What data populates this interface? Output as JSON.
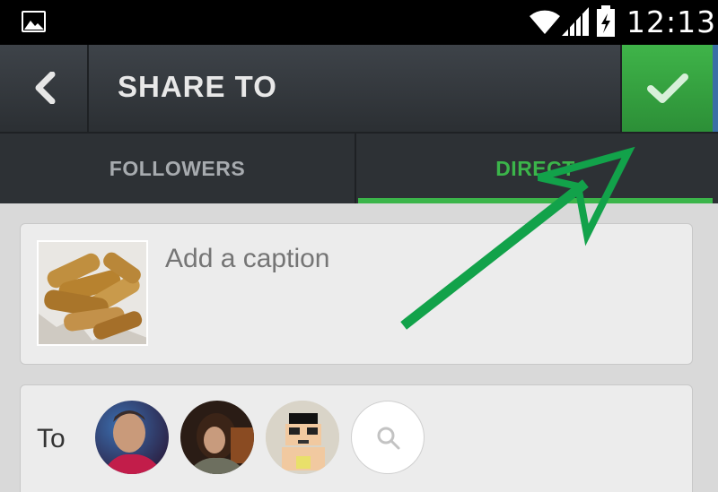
{
  "status_bar": {
    "time": "12:13",
    "icons": [
      "gallery-icon",
      "wifi-icon",
      "signal-icon",
      "battery-charging-icon"
    ]
  },
  "header": {
    "title": "SHARE TO",
    "back_icon": "chevron-left-icon",
    "confirm_icon": "checkmark-icon",
    "accent_color": "#3bb54a"
  },
  "tabs": [
    {
      "label": "FOLLOWERS",
      "active": false
    },
    {
      "label": "DIRECT",
      "active": true
    }
  ],
  "caption": {
    "placeholder": "Add a caption",
    "value": ""
  },
  "recipients": {
    "label": "To",
    "search_icon": "search-icon"
  },
  "annotation": {
    "type": "arrow",
    "color": "#13a04a",
    "points_to": "confirm-button"
  }
}
